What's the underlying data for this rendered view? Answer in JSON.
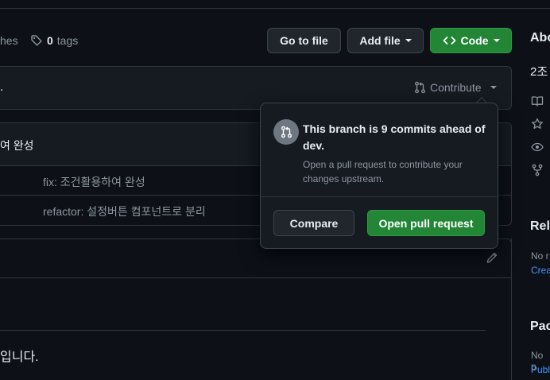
{
  "repo": {
    "branches_label_fragment": "hes",
    "tags_count": "0",
    "tags_label": "tags",
    "go_to_file": "Go to file",
    "add_file": "Add file",
    "code": "Code",
    "branch_status_fragment": ".",
    "contribute": "Contribute",
    "commit_header_fragment": "여 완성",
    "commits": [
      {
        "message": "fix: 조건활용하여 완성"
      },
      {
        "message": "refactor: 설정버튼 컴포넌트로 분리"
      }
    ],
    "readme_text_fragment": "입니다."
  },
  "sidebar": {
    "about_fragment": "Abo",
    "desc_fragment": "2조",
    "releases_fragment": "Rele",
    "releases_note_fragment": "No r",
    "releases_link_fragment": "Crea",
    "packages_fragment": "Pac",
    "packages_note_fragment": "No p",
    "packages_link_fragment": "Publ"
  },
  "popover": {
    "title": "This branch is 9 commits ahead of dev.",
    "description": "Open a pull request to contribute your changes upstream.",
    "compare": "Compare",
    "open_pr": "Open pull request"
  },
  "colors": {
    "background": "#0d1117",
    "surface": "#161b22",
    "border": "#30363d",
    "green": "#238636",
    "link": "#4493f8"
  }
}
